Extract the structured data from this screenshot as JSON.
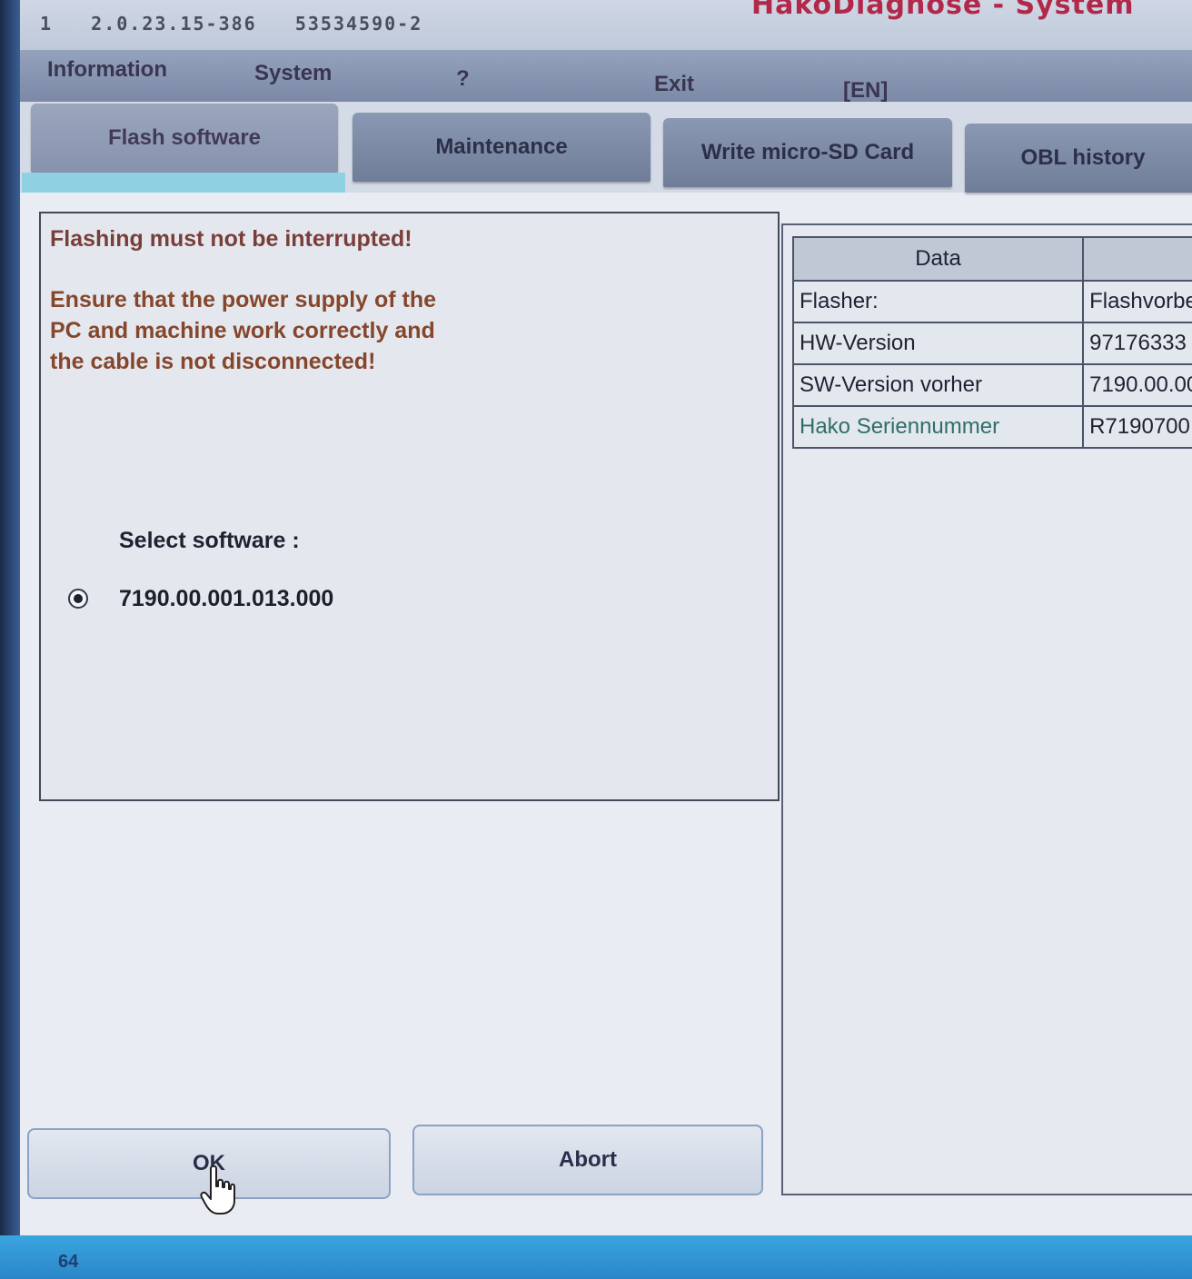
{
  "titlebar": {
    "build_info": "1   2.0.23.15-386   53534590-2",
    "app_title": "HakoDiagnose - System"
  },
  "menu": {
    "items": [
      {
        "label": "Information"
      },
      {
        "label": "System"
      },
      {
        "label": "?"
      },
      {
        "label": "Exit"
      },
      {
        "label": "[EN]"
      }
    ]
  },
  "tabs": {
    "active_index": 0,
    "items": [
      {
        "label": "Flash software"
      },
      {
        "label": "Maintenance"
      },
      {
        "label": "Write micro-SD Card"
      },
      {
        "label": "OBL history"
      }
    ]
  },
  "flash_panel": {
    "warning_title": "Flashing must not be interrupted!",
    "warning_body": "Ensure that the power supply of the PC and machine work correctly and the cable is not disconnected!",
    "select_label": "Select software :",
    "software_option": "7190.00.001.013.000",
    "software_selected": true
  },
  "data_table": {
    "header": [
      "Data",
      ""
    ],
    "rows": [
      {
        "key": "Flasher:",
        "value": "Flashvorbe"
      },
      {
        "key": "HW-Version",
        "value": "97176333"
      },
      {
        "key": "SW-Version vorher",
        "value": "7190.00.00"
      },
      {
        "key": "Hako Seriennummer",
        "value": "R7190700"
      }
    ]
  },
  "buttons": {
    "ok_label": "OK",
    "abort_label": "Abort"
  },
  "taskbar": {
    "text": "64"
  },
  "colors": {
    "app_title": "#b2284a",
    "warning_text": "#85462c",
    "tab_indicator": "#8fd0e2",
    "taskbar": "#2b86c8"
  }
}
